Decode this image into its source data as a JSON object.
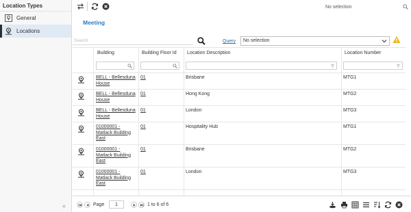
{
  "sidebar": {
    "title": "Location Types",
    "items": [
      {
        "label": "General",
        "icon": "general-location-icon",
        "active": false
      },
      {
        "label": "Locations",
        "icon": "location-pin-icon",
        "active": true
      }
    ],
    "collapse_glyph": "«"
  },
  "toolbar": {
    "icons": [
      "swap-icon",
      "refresh-icon",
      "close-icon"
    ],
    "selection_text": "No selection"
  },
  "record": {
    "title": "Meeting"
  },
  "search": {
    "placeholder": "Search",
    "value": ""
  },
  "query": {
    "link_label": "Query",
    "selected": "No selection"
  },
  "grid": {
    "columns": [
      "Building",
      "Building Floor Id",
      "Location Description",
      "Location Number"
    ],
    "rows": [
      {
        "building_line1": "BELL - Bellesduna",
        "building_line2": "House",
        "building_line3": "",
        "floor": "01",
        "description": "Brisbane",
        "number": "MTG1"
      },
      {
        "building_line1": "BELL - Bellesduna",
        "building_line2": "House",
        "building_line3": "",
        "floor": "01",
        "description": "Hong Kong",
        "number": "MTG2"
      },
      {
        "building_line1": "BELL - Bellesduna",
        "building_line2": "House",
        "building_line3": "",
        "floor": "01",
        "description": "London",
        "number": "MTG3"
      },
      {
        "building_line1": "01000001 -",
        "building_line2": "Matlack Building",
        "building_line3": "East",
        "floor": "01",
        "description": "Hospitality Hub",
        "number": "MTG1"
      },
      {
        "building_line1": "01000001 -",
        "building_line2": "Matlack Building",
        "building_line3": "East",
        "floor": "01",
        "description": "Brisbane",
        "number": "MTG2"
      },
      {
        "building_line1": "01000001 -",
        "building_line2": "Matlack Building",
        "building_line3": "East",
        "floor": "01",
        "description": "London",
        "number": "MTG3"
      }
    ]
  },
  "pagination": {
    "page_label": "Page",
    "page_value": "1",
    "range_text": "1 to 6 of 6"
  },
  "footer_icons": [
    "import-icon",
    "print-icon",
    "columns-icon",
    "list-view-icon",
    "sort-icon",
    "refresh-icon",
    "close-icon"
  ],
  "colors": {
    "accent": "#2a7bbf",
    "active_nav": "#dfeaf4",
    "warning": "#f2b705"
  }
}
